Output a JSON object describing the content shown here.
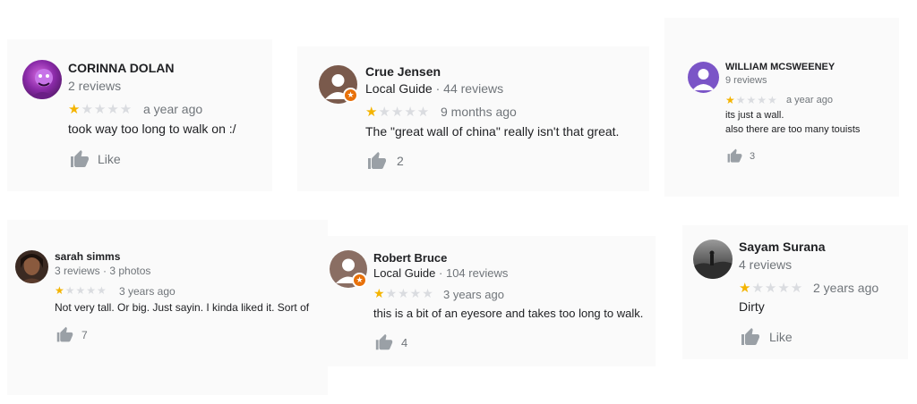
{
  "colors": {
    "star_on": "#f4b400",
    "star_off": "#dadce0",
    "guide_badge": "#e8710a",
    "muted": "#70757a"
  },
  "reviews": [
    {
      "name": "CORINNA DOLAN",
      "meta": "2 reviews",
      "rating": 1,
      "time": "a year ago",
      "text": [
        "took way too long to walk on :/"
      ],
      "likes": "Like",
      "icon": "thumbs-up-icon"
    },
    {
      "name": "Crue Jensen",
      "guide": "Local Guide",
      "meta": "44 reviews",
      "rating": 1,
      "time": "9 months ago",
      "text": [
        "The \"great wall of china\" really isn't that great."
      ],
      "likes": "2",
      "icon": "thumbs-up-icon"
    },
    {
      "name": "WILLIAM MCSWEENEY",
      "meta": "9 reviews",
      "rating": 1,
      "time": "a year ago",
      "text": [
        "its just a wall.",
        "also there are too many touists"
      ],
      "likes": "3",
      "icon": "thumbs-up-icon"
    },
    {
      "name": "sarah simms",
      "meta": "3 reviews · 3 photos",
      "rating": 1,
      "time": "3 years ago",
      "text": [
        "Not very tall. Or big. Just sayin. I kinda liked it. Sort of"
      ],
      "likes": "7",
      "icon": "thumbs-up-icon"
    },
    {
      "name": "Robert Bruce",
      "guide": "Local Guide",
      "meta": "104 reviews",
      "rating": 1,
      "time": "3 years ago",
      "text": [
        "this is a bit of an eyesore and takes too long to walk."
      ],
      "likes": "4",
      "icon": "thumbs-up-icon"
    },
    {
      "name": "Sayam Surana",
      "meta": "4 reviews",
      "rating": 1,
      "time": "2 years ago",
      "text": [
        "Dirty"
      ],
      "likes": "Like",
      "icon": "thumbs-up-icon"
    }
  ]
}
